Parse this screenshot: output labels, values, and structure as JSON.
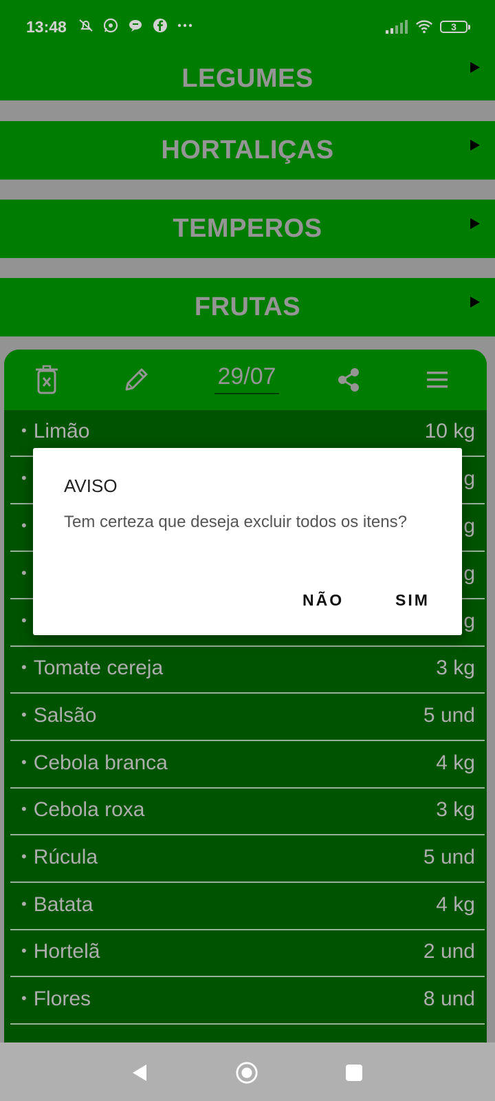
{
  "status_bar": {
    "time": "13:48",
    "battery": "3",
    "icons": [
      "muted-alarm-icon",
      "whatsapp-icon",
      "chat-icon",
      "facebook-icon",
      "more-icon",
      "signal-icon",
      "wifi-icon",
      "battery-icon"
    ]
  },
  "categories": [
    {
      "label": "LEGUMES"
    },
    {
      "label": "HORTALIÇAS"
    },
    {
      "label": "TEMPEROS"
    },
    {
      "label": "FRUTAS"
    }
  ],
  "toolbar": {
    "date": "29/07",
    "icons": [
      "trash-icon",
      "pencil-icon",
      "share-icon",
      "menu-icon"
    ]
  },
  "items": [
    {
      "name": "Limão",
      "qty": "10 kg"
    },
    {
      "name": "",
      "qty": "g"
    },
    {
      "name": "",
      "qty": "g"
    },
    {
      "name": "",
      "qty": "g"
    },
    {
      "name": "",
      "qty": "g"
    },
    {
      "name": "Tomate cereja",
      "qty": "3 kg"
    },
    {
      "name": "Salsão",
      "qty": "5 und"
    },
    {
      "name": "Cebola branca",
      "qty": "4 kg"
    },
    {
      "name": "Cebola roxa",
      "qty": "3 kg"
    },
    {
      "name": "Rúcula",
      "qty": "5 und"
    },
    {
      "name": "Batata",
      "qty": "4 kg"
    },
    {
      "name": "Hortelã",
      "qty": "2 und"
    },
    {
      "name": "Flores",
      "qty": "8 und"
    }
  ],
  "dialog": {
    "title": "AVISO",
    "message": "Tem certeza que deseja excluir todos os itens?",
    "no_label": "NÃO",
    "yes_label": "SIM"
  },
  "colors": {
    "primary_green": "#009900",
    "list_green": "#006600",
    "category_text": "#b6b6b6",
    "background_gray": "#b4b4b4"
  }
}
